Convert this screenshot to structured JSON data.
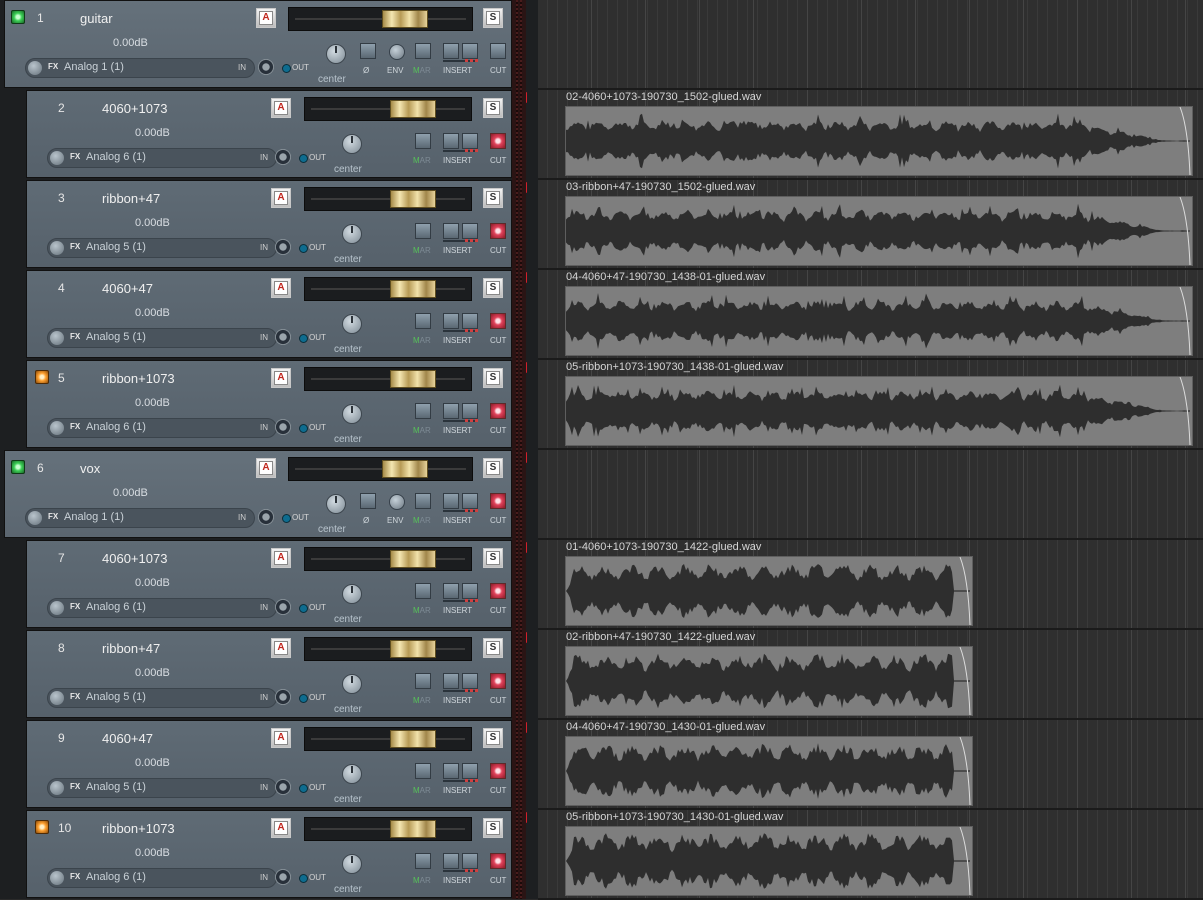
{
  "colors": {
    "tcp_bg": "#5f6b75",
    "item_bg": "#7e7e7e",
    "waveform": "#2e2e2e",
    "mute_red": "#d21f2b",
    "fader_gold": "#d9c384",
    "arm_green": "#3ccf56",
    "arm_orange": "#ffa12f"
  },
  "labels": {
    "fx": "FX",
    "in": "IN",
    "out": "OUT",
    "phase": "Ø",
    "env": "ENV",
    "mar_m": "M",
    "mar_ar": "AR",
    "insert": "INSERT",
    "cut": "CUT",
    "auto": "A",
    "solo": "S",
    "mute": "M"
  },
  "tracks": [
    {
      "num": "1",
      "name": "guitar",
      "volume": "0.00dB",
      "input": "Analog 1 (1)",
      "pan": "center",
      "folder": true,
      "rec_arm": "green",
      "cut_active": false,
      "has_env": true,
      "muted": false
    },
    {
      "num": "2",
      "name": "4060+1073",
      "volume": "0.00dB",
      "input": "Analog 6 (1)",
      "pan": "center",
      "folder": false,
      "rec_arm": null,
      "cut_active": true,
      "has_env": false,
      "muted": true,
      "item": {
        "name": "02-4060+1073-190730_1502-glued.wav",
        "length": "long"
      }
    },
    {
      "num": "3",
      "name": "ribbon+47",
      "volume": "0.00dB",
      "input": "Analog 5 (1)",
      "pan": "center",
      "folder": false,
      "rec_arm": null,
      "cut_active": true,
      "has_env": false,
      "muted": true,
      "item": {
        "name": "03-ribbon+47-190730_1502-glued.wav",
        "length": "long"
      }
    },
    {
      "num": "4",
      "name": "4060+47",
      "volume": "0.00dB",
      "input": "Analog 5 (1)",
      "pan": "center",
      "folder": false,
      "rec_arm": null,
      "cut_active": true,
      "has_env": false,
      "muted": true,
      "item": {
        "name": "04-4060+47-190730_1438-01-glued.wav",
        "length": "long"
      }
    },
    {
      "num": "5",
      "name": "ribbon+1073",
      "volume": "0.00dB",
      "input": "Analog 6 (1)",
      "pan": "center",
      "folder": false,
      "rec_arm": "orange",
      "cut_active": true,
      "has_env": false,
      "muted": true,
      "item": {
        "name": "05-ribbon+1073-190730_1438-01-glued.wav",
        "length": "long"
      }
    },
    {
      "num": "6",
      "name": "vox",
      "volume": "0.00dB",
      "input": "Analog 1 (1)",
      "pan": "center",
      "folder": true,
      "rec_arm": "green",
      "cut_active": true,
      "has_env": true,
      "muted": true
    },
    {
      "num": "7",
      "name": "4060+1073",
      "volume": "0.00dB",
      "input": "Analog 6 (1)",
      "pan": "center",
      "folder": false,
      "rec_arm": null,
      "cut_active": true,
      "has_env": false,
      "muted": true,
      "item": {
        "name": "01-4060+1073-190730_1422-glued.wav",
        "length": "short"
      }
    },
    {
      "num": "8",
      "name": "ribbon+47",
      "volume": "0.00dB",
      "input": "Analog 5 (1)",
      "pan": "center",
      "folder": false,
      "rec_arm": null,
      "cut_active": true,
      "has_env": false,
      "muted": true,
      "item": {
        "name": "02-ribbon+47-190730_1422-glued.wav",
        "length": "short"
      }
    },
    {
      "num": "9",
      "name": "4060+47",
      "volume": "0.00dB",
      "input": "Analog 5 (1)",
      "pan": "center",
      "folder": false,
      "rec_arm": null,
      "cut_active": true,
      "has_env": false,
      "muted": true,
      "item": {
        "name": "04-4060+47-190730_1430-01-glued.wav",
        "length": "short"
      }
    },
    {
      "num": "10",
      "name": "ribbon+1073",
      "volume": "0.00dB",
      "input": "Analog 6 (1)",
      "pan": "center",
      "folder": false,
      "rec_arm": "orange",
      "cut_active": true,
      "has_env": false,
      "muted": true,
      "item": {
        "name": "05-ribbon+1073-190730_1430-01-glued.wav",
        "length": "short"
      }
    }
  ]
}
